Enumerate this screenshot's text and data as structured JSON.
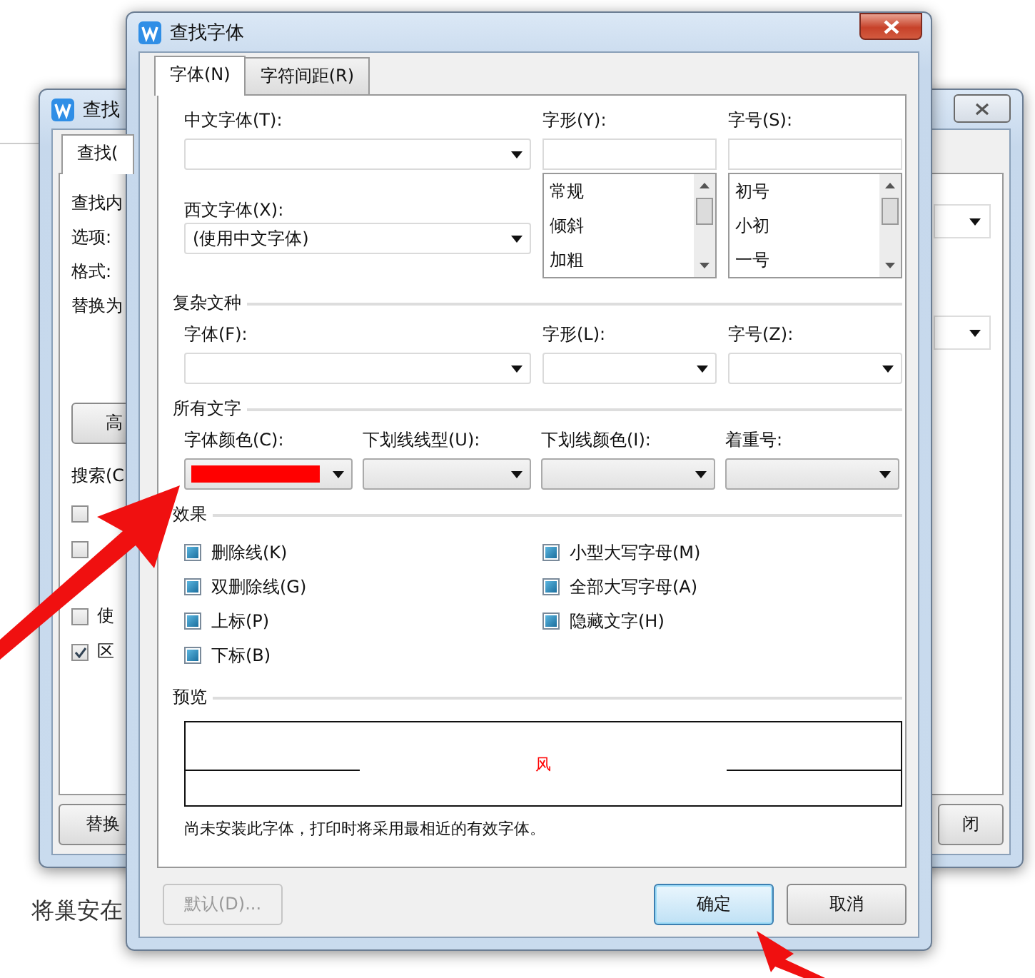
{
  "background_page": {
    "paragraph": "将巢安在"
  },
  "back_dialog": {
    "title": "查找",
    "tab": "查找(",
    "labels": [
      "查找内",
      "选项:",
      "格式:",
      "替换为"
    ],
    "advanced_button": "高",
    "search_label": "搜索(C",
    "checkboxes": [
      {
        "checked": false
      },
      {
        "checked": false
      },
      {
        "label": "使",
        "checked": false
      },
      {
        "label": "区",
        "checked": true
      }
    ],
    "replace_button": "替换",
    "close_button": "闭"
  },
  "dialog": {
    "title": "查找字体",
    "tabs": [
      {
        "label": "字体(N)",
        "selected": true
      },
      {
        "label": "字符间距(R)",
        "selected": false
      }
    ],
    "chinese_font": {
      "label": "中文字体(T):"
    },
    "western_font": {
      "label": "西文字体(X):",
      "value": "(使用中文字体)"
    },
    "style": {
      "label": "字形(Y):",
      "options": [
        "常规",
        "倾斜",
        "加粗"
      ]
    },
    "size": {
      "label": "字号(S):",
      "options": [
        "初号",
        "小初",
        "一号"
      ]
    },
    "complex_script": {
      "heading": "复杂文种",
      "fields": [
        "字体(F):",
        "字形(L):",
        "字号(Z):"
      ]
    },
    "all_text": {
      "heading": "所有文字",
      "fields": [
        {
          "label": "字体颜色(C):",
          "color": "#ff0000"
        },
        {
          "label": "下划线线型(U):"
        },
        {
          "label": "下划线颜色(I):"
        },
        {
          "label": "着重号:"
        }
      ]
    },
    "effects": {
      "heading": "效果",
      "options": [
        {
          "label": "删除线(K)",
          "indeterminate": true
        },
        {
          "label": "双删除线(G)",
          "indeterminate": true
        },
        {
          "label": "上标(P)",
          "indeterminate": true
        },
        {
          "label": "下标(B)",
          "indeterminate": true
        },
        {
          "label": "小型大写字母(M)",
          "indeterminate": true
        },
        {
          "label": "全部大写字母(A)",
          "indeterminate": true
        },
        {
          "label": "隐藏文字(H)",
          "indeterminate": true
        }
      ]
    },
    "preview": {
      "heading": "预览",
      "sample": "风"
    },
    "note": "尚未安装此字体，打印时将采用最相近的有效字体。",
    "buttons": [
      {
        "label": "默认(D)...",
        "disabled": true,
        "default": false
      },
      {
        "label": "确定",
        "disabled": false,
        "default": true
      },
      {
        "label": "取消",
        "disabled": false,
        "default": false
      }
    ]
  }
}
